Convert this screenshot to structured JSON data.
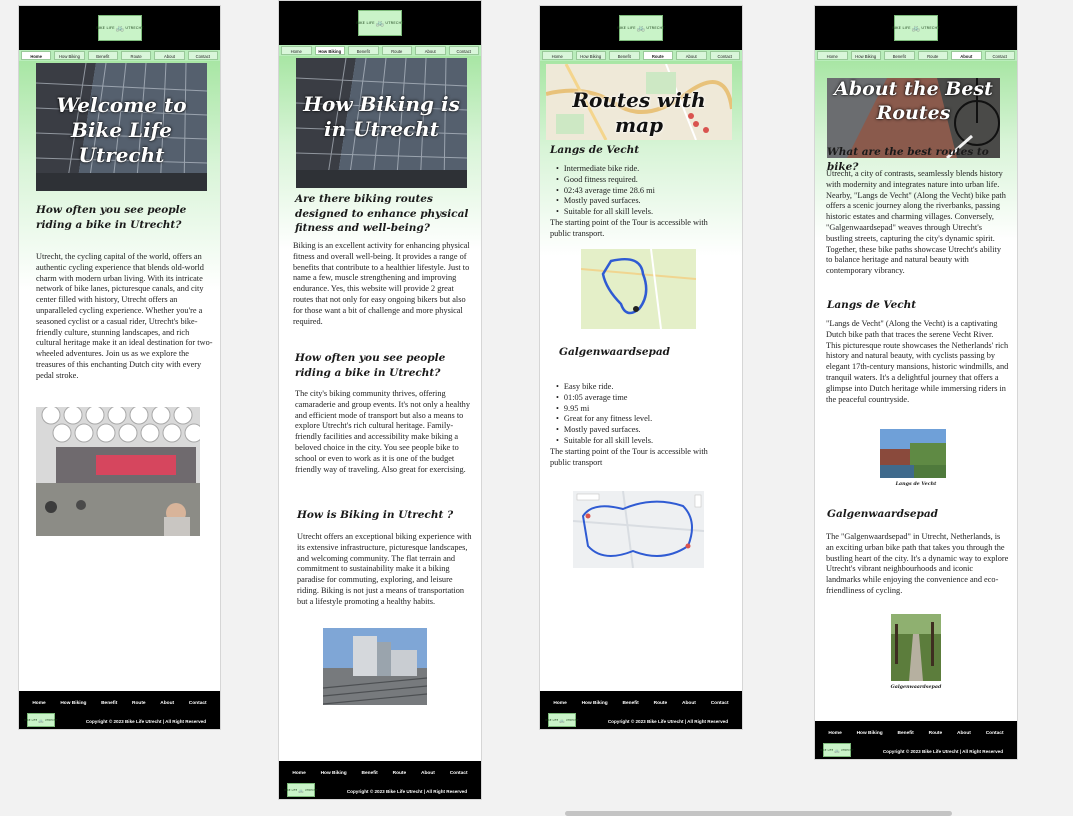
{
  "site": {
    "logo_text_left": "BIKE LIFE",
    "logo_text_right": "UTRECHT",
    "nav": [
      "Home",
      "How Biking",
      "Benefit",
      "Route",
      "About",
      "Contact"
    ],
    "footer_links": [
      "Home",
      "How Biking",
      "Benefit",
      "Route",
      "About",
      "Contact"
    ],
    "copyright": "Copyright © 2023 Bike Life Utrecht | All Right Reserved"
  },
  "home": {
    "active_nav": "Home",
    "hero_title": "Welcome to Bike Life Utrecht",
    "heading": "How often you see people riding a bike in Utrecht?",
    "paragraph": "Utrecht, the cycling capital of the world, offers an authentic cycling experience that blends old-world charm with modern urban living. With its intricate network of bike lanes, picturesque canals, and city center filled with history, Utrecht offers an unparalleled cycling experience. Whether you're a seasoned cyclist or a casual rider, Utrecht's bike-friendly culture, stunning landscapes, and rich cultural heritage make it an ideal destination for two-wheeled adventures. Join us as we explore the treasures of this enchanting Dutch city with every pedal stroke."
  },
  "how": {
    "active_nav": "How Biking",
    "hero_title": "How Biking is in Utrecht",
    "heading1": "Are there biking routes designed to enhance physical fitness and well-being?",
    "para1": "Biking is an excellent activity for enhancing physical fitness and overall well-being. It provides a range of benefits that contribute to a healthier lifestyle. Just to name a few, muscle strengthening and improving endurance. Yes, this website will provide 2 great routes that not only for easy ongoing bikers but also for those want a bit of challenge and more physical required.",
    "heading2": "How often you see people riding a bike in Utrecht?",
    "para2": "The city's biking community thrives, offering camaraderie and group events. It's not only a healthy and efficient mode of transport but also a means to explore Utrecht's rich cultural heritage. Family-friendly facilities and accessibility make biking a beloved choice in the city. You see people bike to school or even to work as it is one of the budget friendly way of traveling. Also great for exercising.",
    "heading3": "How is Biking in Utrecht ?",
    "para3": "Utrecht offers an exceptional biking experience with its extensive infrastructure, picturesque landscapes, and welcoming community. The flat terrain and commitment to sustainability make it a biking paradise for commuting, exploring, and leisure riding. Biking is not just a means of transportation but a lifestyle promoting a healthy habits."
  },
  "routes": {
    "active_nav": "Route",
    "hero_title": "Routes with map",
    "route1_title": "Langs de Vecht",
    "route1_items": [
      "Intermediate bike ride.",
      "Good fitness required.",
      "02:43 average time 28.6 mi",
      "Mostly paved surfaces.",
      "Suitable for all skill levels."
    ],
    "route1_note": "The starting point of the Tour is accessible with public transport.",
    "route2_title": "Galgenwaardsepad",
    "route2_items": [
      "Easy bike ride.",
      "01:05 average time",
      "9.95 mi",
      "Great for any fitness level.",
      "Mostly paved surfaces.",
      "Suitable for all skill levels."
    ],
    "route2_note": "The starting point of the Tour is accessible with public transport"
  },
  "about": {
    "active_nav": "About",
    "hero_title": "About the Best Routes",
    "heading": "What are the best routes to bike?",
    "para1": "Utrecht, a city of contrasts, seamlessly blends history with modernity and integrates nature into urban life. Nearby, \"Langs de Vecht\" (Along the Vecht) bike path offers a scenic journey along the riverbanks, passing historic estates and charming villages. Conversely, \"Galgenwaardsepad\" weaves through Utrecht's bustling streets, capturing the city's dynamic spirit. Together, these bike paths showcase Utrecht's ability to balance heritage and natural beauty with contemporary vibrancy.",
    "heading2": "Langs de Vecht",
    "para2": "\"Langs de Vecht\" (Along the Vecht) is a captivating Dutch bike path that traces the serene Vecht River. This picturesque route showcases the Netherlands' rich history and natural beauty, with cyclists passing by elegant 17th-century mansions, historic windmills, and tranquil waters. It's a delightful journey that offers a glimpse into Dutch heritage while immersing riders in the peaceful countryside.",
    "caption1": "Langs de Vecht",
    "heading3": "Galgenwaardsepad",
    "para3": "The \"Galgenwaardsepad\" in Utrecht, Netherlands, is an exciting urban bike path that takes you through the bustling heart of the city. It's a dynamic way to explore Utrecht's vibrant neighbourhoods and iconic landmarks while enjoying the convenience and eco-friendliness of cycling.",
    "caption2": "Galgenwaardsepad"
  },
  "colors": {
    "header": "#000000",
    "accent_green": "#b9edbb",
    "logo_bg": "#c9f3c8"
  }
}
